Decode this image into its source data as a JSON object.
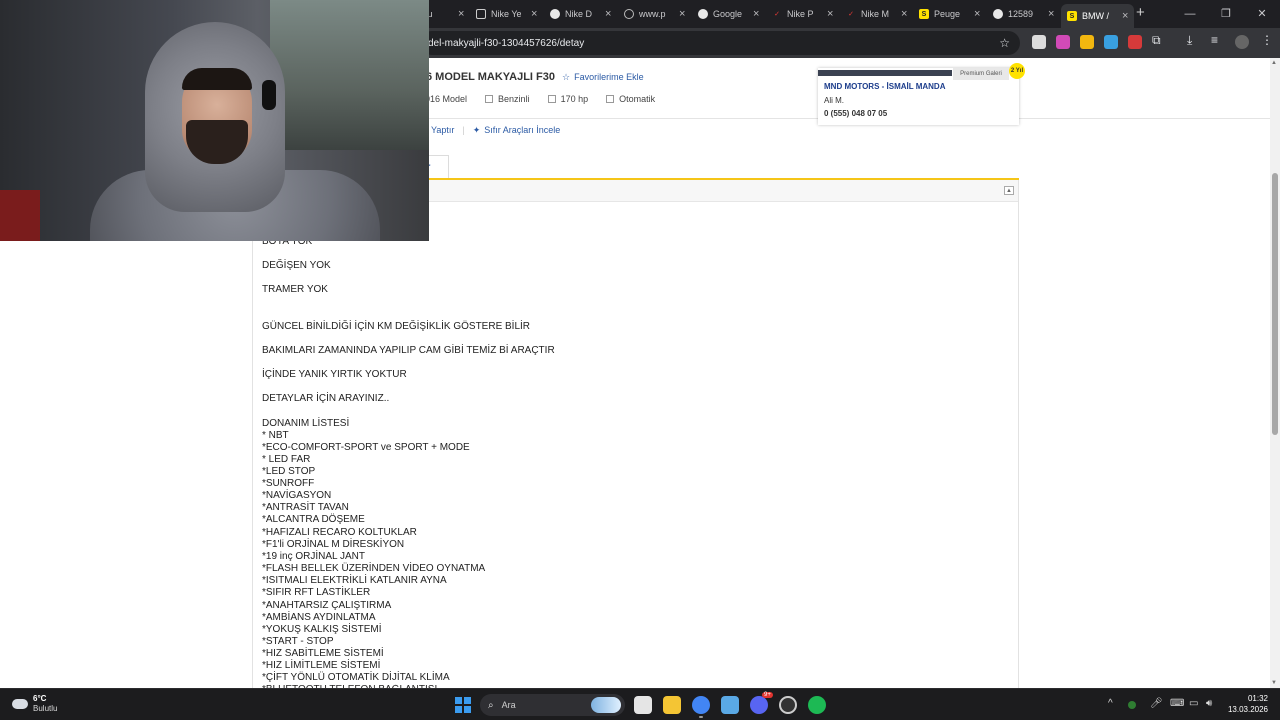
{
  "browser": {
    "tabs": [
      {
        "label": "e lu",
        "icon": "globe-icon"
      },
      {
        "label": "Nike Ye",
        "icon": "bookmark-icon"
      },
      {
        "label": "Nike D",
        "icon": "edge-icon"
      },
      {
        "label": "www.p",
        "icon": "globe-icon"
      },
      {
        "label": "Google",
        "icon": "google-icon"
      },
      {
        "label": "Nike P",
        "icon": "nike-icon"
      },
      {
        "label": "Nike M",
        "icon": "nike-icon"
      },
      {
        "label": "Peuge",
        "icon": "sahibinden-icon"
      },
      {
        "label": "12589",
        "icon": "google-icon"
      },
      {
        "label": "BMW /",
        "icon": "sahibinden-icon"
      }
    ],
    "url": "del-makyajli-f30-1304457626/detay"
  },
  "listing": {
    "title": "6 MODEL MAKYAJLI F30",
    "favorite_label": "Favorilerime Ekle",
    "specs": {
      "year": "2016 Model",
      "fuel": "Benzinli",
      "power": "170 hp",
      "gear": "Otomatik"
    },
    "link_partial": "Yaptır",
    "link_new_cars": "Sıfır Araçları İncele",
    "tab_partial": "er"
  },
  "dealer": {
    "badge": "Premium Galeri",
    "seal": "2 Yıl",
    "name": "MND MOTORS - İSMAİL MANDA",
    "person": "Ali M.",
    "phone": "0 (555) 048 07 05"
  },
  "description": {
    "lines": [
      "BOYA YOK",
      "DEĞİŞEN YOK",
      "TRAMER YOK",
      "GÜNCEL BİNİLDİĞİ İÇİN KM DEĞİŞİKLİK GÖSTERE BİLİR",
      "BAKIMLARI ZAMANINDA YAPILIP CAM GİBİ TEMİZ Bİ ARAÇTIR",
      "İÇİNDE YANIK YIRTIK YOKTUR",
      "DETAYLAR İÇİN ARAYINIZ..",
      "DONANIM LİSTESİ",
      "* NBT",
      "*ECO-COMFORT-SPORT ve SPORT + MODE",
      "* LED FAR",
      "*LED STOP",
      "*SUNROFF",
      "*NAVİGASYON",
      "*ANTRASİT TAVAN",
      "*ALCANTRA DÖŞEME",
      "*HAFIZALI RECARO KOLTUKLAR",
      "*F1'li ORJİNAL M DİRESKİYON",
      "*19 inç ORJİNAL JANT",
      "*FLASH BELLEK ÜZERİNDEN VİDEO OYNATMA",
      "*ISITMALI ELEKTRİKLİ KATLANIR AYNA",
      "*SIFIR RFT LASTİKLER",
      "*ANAHTARSIZ ÇALIŞTIRMA",
      "*AMBİANS AYDINLATMA",
      "*YOKUŞ KALKIŞ SİSTEMİ",
      "*START - STOP",
      "*HIZ SABİTLEME SİSTEMİ",
      "*HIZ LİMİTLEME SİSTEMİ",
      "*ÇİFT YÖNLÜ OTOMATİK DİJİTAL KLİMA",
      "*BLUETOOTH TELEFON BAĞLANTISI"
    ]
  },
  "taskbar": {
    "weather_temp": "6°C",
    "weather_desc": "Bulutlu",
    "search_label": "Ara",
    "time": "01:32",
    "date": "13.03.2026",
    "discord_badge": "9+"
  },
  "colors": {
    "link": "#2c5ba5",
    "accent_yellow": "#f5c518",
    "dealer_name": "#1c3d8c"
  }
}
